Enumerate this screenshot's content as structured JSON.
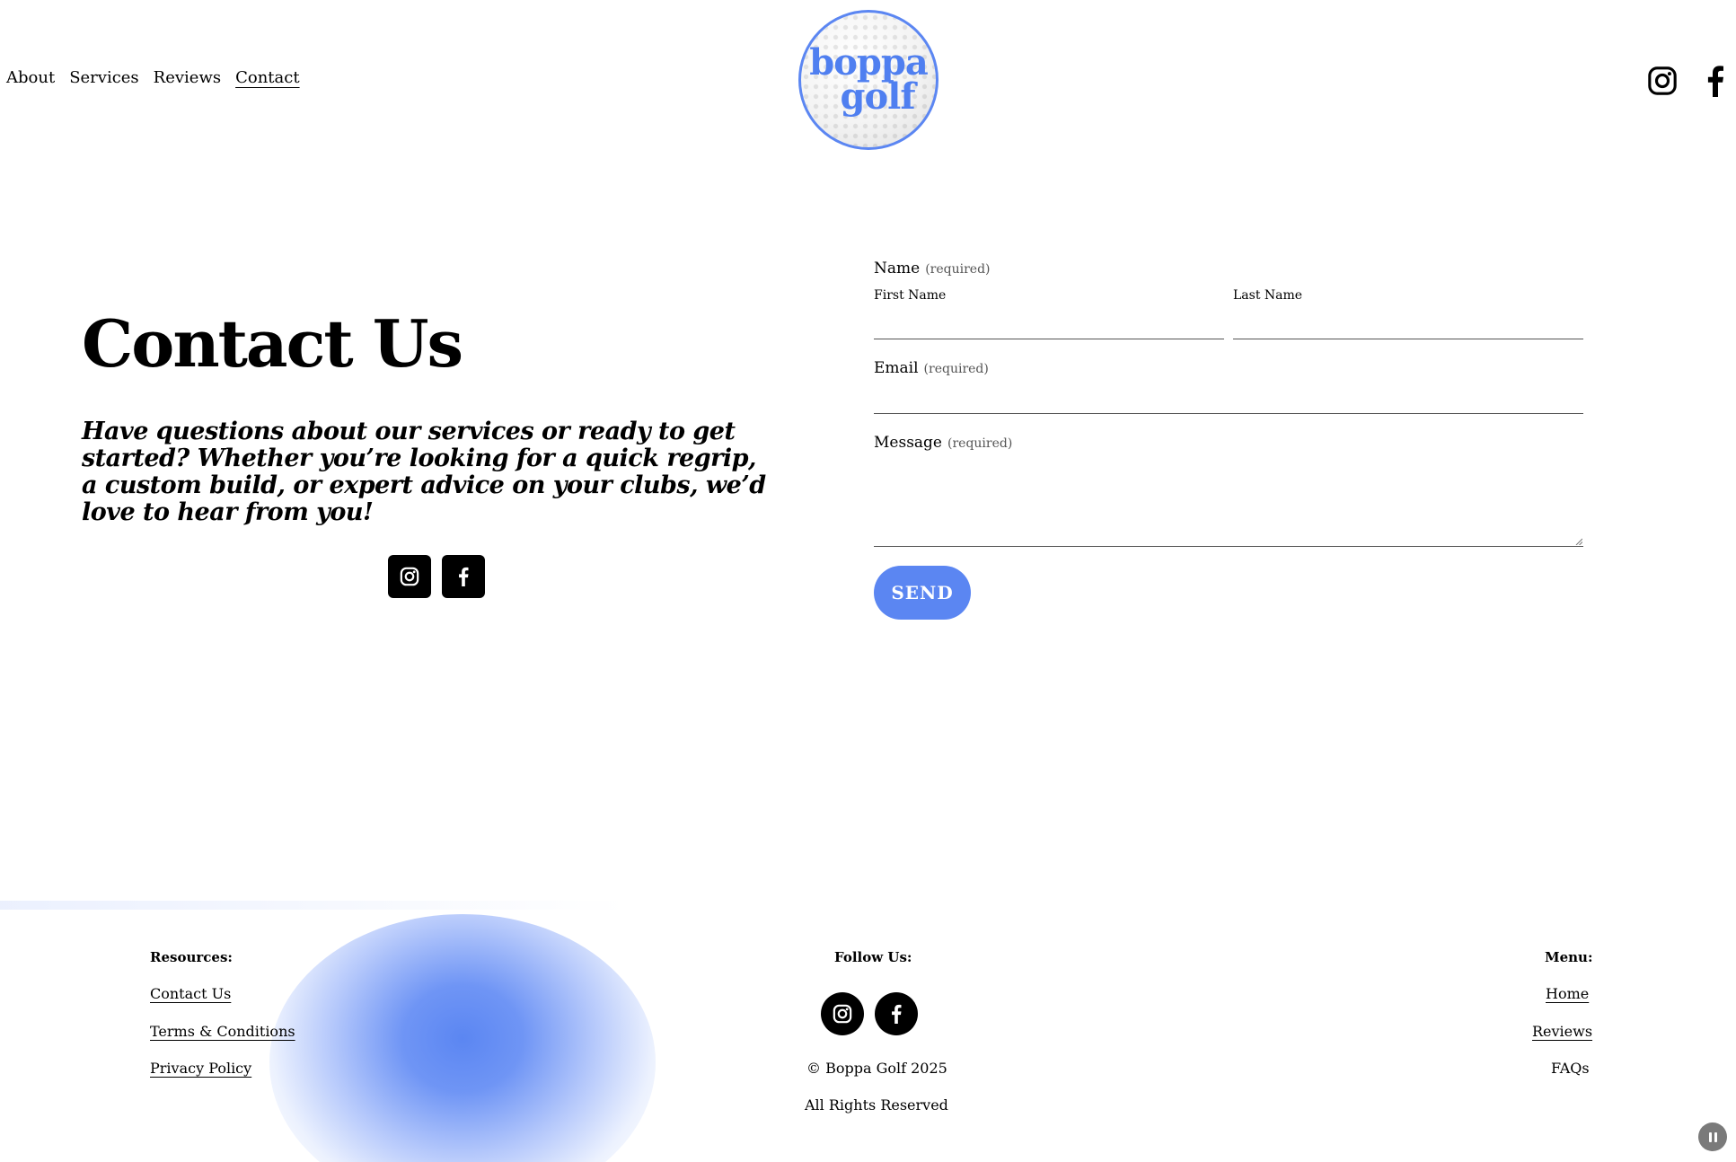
{
  "header": {
    "nav": [
      {
        "label": "About",
        "active": false
      },
      {
        "label": "Services",
        "active": false
      },
      {
        "label": "Reviews",
        "active": false
      },
      {
        "label": "Contact",
        "active": true
      }
    ],
    "logo": {
      "line1": "boppa",
      "line2": "golf"
    },
    "social_icons": [
      "instagram-icon",
      "facebook-icon"
    ]
  },
  "main": {
    "title": "Contact Us",
    "intro": "Have questions about our services or ready to get started? Whether you’re looking for a quick regrip, a custom build, or expert advice on your clubs, we’d love to hear from you!",
    "social_icons": [
      "instagram-icon",
      "facebook-icon"
    ]
  },
  "form": {
    "name_label": "Name",
    "name_required": "(required)",
    "first_name_label": "First Name",
    "first_name_value": "",
    "last_name_label": "Last Name",
    "last_name_value": "",
    "email_label": "Email",
    "email_required": "(required)",
    "email_value": "",
    "message_label": "Message",
    "message_required": "(required)",
    "message_value": "",
    "send_label": "SEND"
  },
  "footer": {
    "resources": {
      "heading": "Resources:",
      "links": [
        "Contact Us",
        "Terms & Conditions",
        "Privacy Policy"
      ]
    },
    "follow": {
      "heading": "Follow Us:",
      "copyright": "© Boppa Golf 2025",
      "rights": "All Rights Reserved"
    },
    "menu": {
      "heading": "Menu:",
      "links": [
        "Home",
        "Reviews",
        "FAQs"
      ]
    }
  },
  "colors": {
    "accent": "#5b86f2",
    "text": "#000000",
    "background": "#ffffff"
  }
}
